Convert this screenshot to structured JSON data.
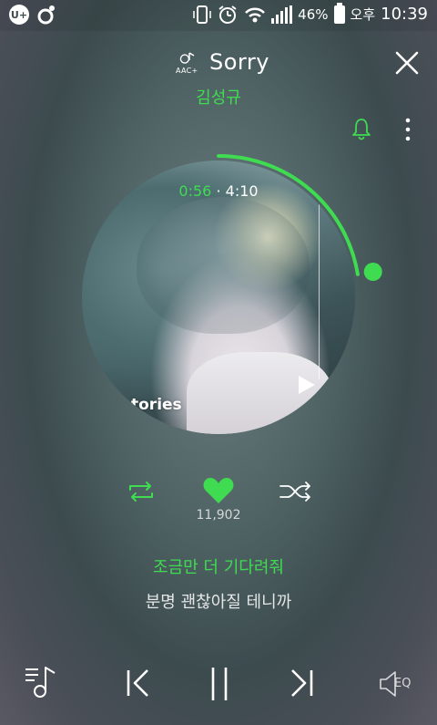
{
  "status_bar": {
    "left_icons": [
      "u-plus-icon",
      "music-app-icon"
    ],
    "u_plus_text": "U+",
    "battery_percent": "46%",
    "ampm": "오후",
    "time": "10:39"
  },
  "header": {
    "badge_text": "AAC+",
    "title": "Sorry",
    "artist": "김성규"
  },
  "player": {
    "current_time": "0:56",
    "separator": "·",
    "total_time": "4:10",
    "progress": 0.224,
    "album_text": "tories",
    "likes": "11,902"
  },
  "lyrics": {
    "current": "조금만 더 기다려줘",
    "next": "분명 괜찮아질 테니까"
  },
  "controls": {
    "eq_label": "EQ"
  },
  "colors": {
    "accent": "#3fdc52",
    "text": "#ffffff"
  }
}
